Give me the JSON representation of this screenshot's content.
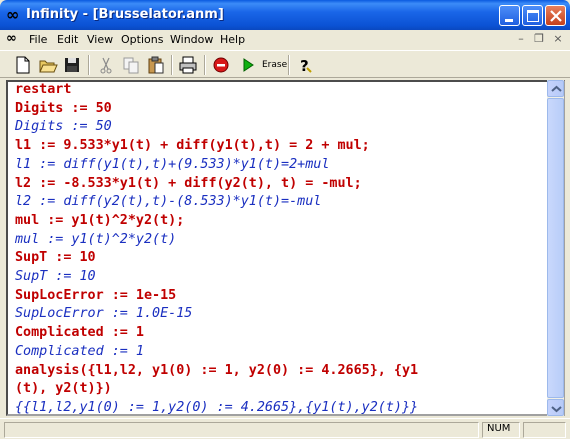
{
  "window": {
    "title": "Infinity - [Brusselator.anm]",
    "app_icon": "infinity-icon"
  },
  "menu": {
    "items": [
      "File",
      "Edit",
      "View",
      "Options",
      "Window",
      "Help"
    ]
  },
  "toolbar": {
    "tools": [
      "new-document-icon",
      "open-folder-icon",
      "save-disk-icon",
      "cut-icon",
      "copy-icon",
      "paste-icon",
      "print-icon",
      "stop-icon",
      "run-icon",
      "erase-label",
      "help-icon"
    ],
    "erase_label": "Erase"
  },
  "editor": {
    "lines": [
      {
        "kind": "cmd",
        "text": "restart"
      },
      {
        "kind": "cmd",
        "text": "Digits := 50"
      },
      {
        "kind": "out",
        "text": "Digits := 50"
      },
      {
        "kind": "cmd",
        "text": "l1 := 9.533*y1(t) + diff(y1(t),t) = 2 + mul;"
      },
      {
        "kind": "out",
        "text": "l1 := diff(y1(t),t)+(9.533)*y1(t)=2+mul"
      },
      {
        "kind": "cmd",
        "text": "l2 := -8.533*y1(t) + diff(y2(t), t) = -mul;"
      },
      {
        "kind": "out",
        "text": "l2 := diff(y2(t),t)-(8.533)*y1(t)=-mul"
      },
      {
        "kind": "cmd",
        "text": "mul := y1(t)^2*y2(t);"
      },
      {
        "kind": "out",
        "text": "mul := y1(t)^2*y2(t)"
      },
      {
        "kind": "cmd",
        "text": "SupT := 10"
      },
      {
        "kind": "out",
        "text": "SupT := 10"
      },
      {
        "kind": "cmd",
        "text": "SupLocError := 1e-15"
      },
      {
        "kind": "out",
        "text": "SupLocError := 1.0E-15"
      },
      {
        "kind": "cmd",
        "text": "Complicated := 1"
      },
      {
        "kind": "out",
        "text": "Complicated := 1"
      },
      {
        "kind": "cmd",
        "text": "analysis({l1,l2, y1(0) := 1, y2(0) := 4.2665}, {y1"
      },
      {
        "kind": "cmd",
        "text": "(t), y2(t)})"
      },
      {
        "kind": "out",
        "text": "{{l1,l2,y1(0) := 1,y2(0) := 4.2665},{y1(t),y2(t)}}"
      }
    ]
  },
  "status": {
    "num": "NUM"
  },
  "colors": {
    "command_text": "#c00000",
    "output_text": "#1a2fc0",
    "title_bar": "#0b52d4"
  }
}
